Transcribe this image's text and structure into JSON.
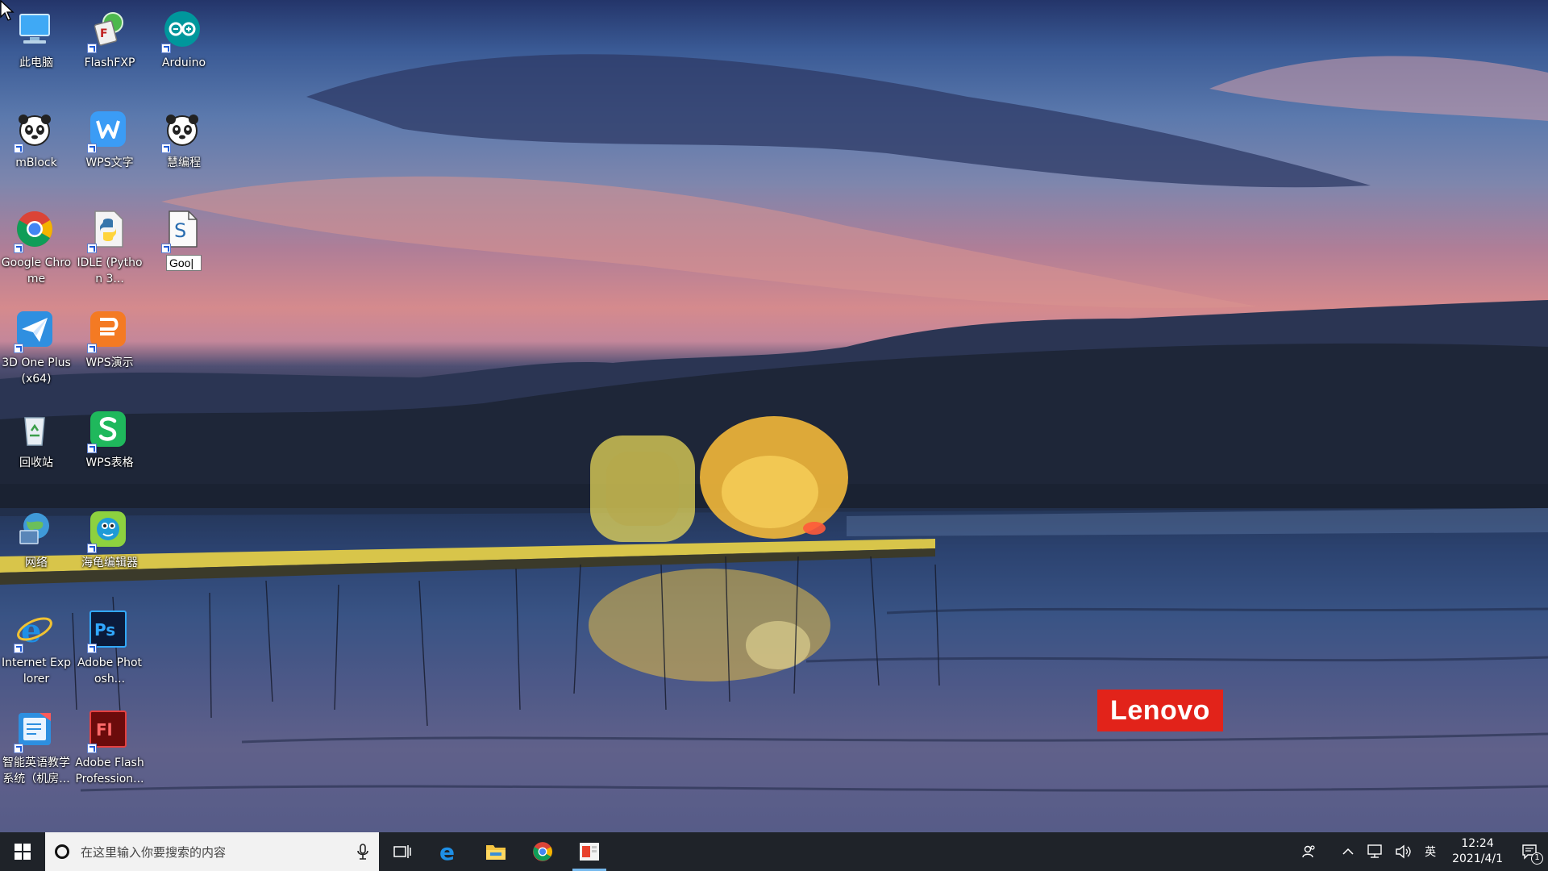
{
  "desktop": {
    "icons": [
      {
        "id": "this-pc",
        "label": "此电脑"
      },
      {
        "id": "flashfxp",
        "label": "FlashFXP"
      },
      {
        "id": "arduino",
        "label": "Arduino"
      },
      {
        "id": "mblock",
        "label": "mBlock"
      },
      {
        "id": "wps-writer",
        "label": "WPS文字"
      },
      {
        "id": "huibiancheng",
        "label": "慧编程"
      },
      {
        "id": "google-chrome",
        "label": "Google Chrome"
      },
      {
        "id": "idle",
        "label": "IDLE (Python 3..."
      },
      {
        "id": "renaming-file",
        "label": "",
        "rename_value": "Goo|"
      },
      {
        "id": "3d-one-plus",
        "label": "3D One Plus (x64)"
      },
      {
        "id": "wps-presentation",
        "label": "WPS演示"
      },
      {
        "id": "recycle-bin",
        "label": "回收站"
      },
      {
        "id": "wps-spreadsheet",
        "label": "WPS表格"
      },
      {
        "id": "network",
        "label": "网络"
      },
      {
        "id": "turtle-editor",
        "label": "海龟编辑器"
      },
      {
        "id": "internet-explorer",
        "label": "Internet Explorer"
      },
      {
        "id": "adobe-photoshop",
        "label": "Adobe Photosh..."
      },
      {
        "id": "english-teaching",
        "label": "智能英语教学系统（机房..."
      },
      {
        "id": "adobe-flash",
        "label": "Adobe Flash Profession..."
      }
    ],
    "brand_badge": "Lenovo"
  },
  "taskbar": {
    "search_placeholder": "在这里输入你要搜索的内容",
    "pinned": [
      "task-view",
      "edge",
      "file-explorer",
      "chrome",
      "presentation-app"
    ],
    "tray": {
      "input_method": "英",
      "time": "12:24",
      "date": "2021/4/1",
      "notification_count": "1"
    }
  },
  "colors": {
    "taskbar_bg": "#1f2329",
    "search_bg": "#f2f2f2",
    "lenovo_red": "#e2231a",
    "active_indicator": "#76b9ed"
  }
}
